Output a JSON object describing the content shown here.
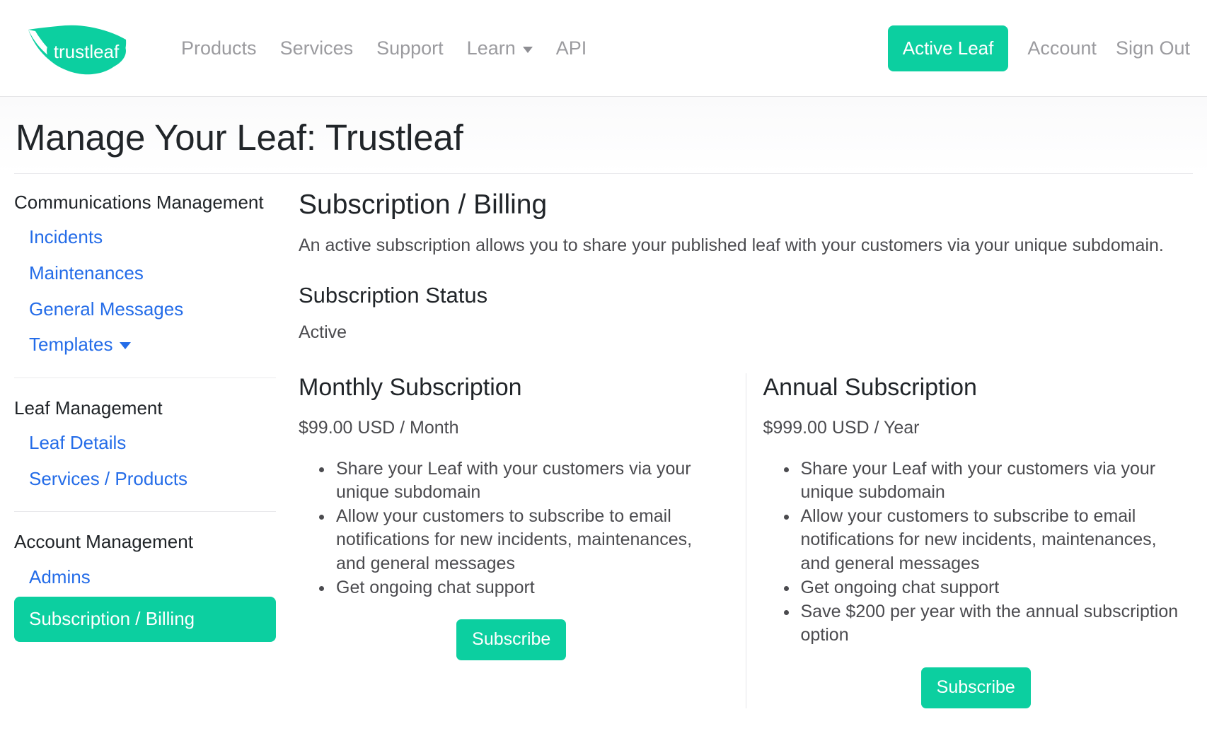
{
  "header": {
    "logo_text": "trustleaf",
    "logo_icon": "leaf-icon",
    "nav_links": [
      {
        "label": "Products"
      },
      {
        "label": "Services"
      },
      {
        "label": "Support"
      },
      {
        "label": "Learn",
        "has_caret": true
      },
      {
        "label": "API"
      }
    ],
    "active_leaf_button": "Active Leaf",
    "account_link": "Account",
    "sign_out_link": "Sign Out",
    "accent_color": "#0ccfa0",
    "nav_text_color": "#9b9b9f"
  },
  "page": {
    "title": "Manage Your Leaf: Trustleaf"
  },
  "sidebar": {
    "groups": [
      {
        "heading": "Communications Management",
        "items": [
          {
            "label": "Incidents",
            "active": false
          },
          {
            "label": "Maintenances",
            "active": false
          },
          {
            "label": "General Messages",
            "active": false
          },
          {
            "label": "Templates",
            "active": false,
            "has_caret": true
          }
        ]
      },
      {
        "heading": "Leaf Management",
        "items": [
          {
            "label": "Leaf Details",
            "active": false
          },
          {
            "label": "Services / Products",
            "active": false
          }
        ]
      },
      {
        "heading": "Account Management",
        "items": [
          {
            "label": "Admins",
            "active": false
          },
          {
            "label": "Subscription / Billing",
            "active": true
          }
        ]
      }
    ],
    "link_color": "#246ce8",
    "active_bg": "#0ccfa0"
  },
  "main": {
    "title": "Subscription / Billing",
    "lead": "An active subscription allows you to share your published leaf with your customers via your unique subdomain.",
    "status_heading": "Subscription Status",
    "status_value": "Active",
    "plans": [
      {
        "title": "Monthly Subscription",
        "price": "$99.00 USD / Month",
        "features": [
          "Share your Leaf with your customers via your unique subdomain",
          "Allow your customers to subscribe to email notifications for new incidents, maintenances, and general messages",
          "Get ongoing chat support"
        ],
        "cta": "Subscribe"
      },
      {
        "title": "Annual Subscription",
        "price": "$999.00 USD / Year",
        "features": [
          "Share your Leaf with your customers via your unique subdomain",
          "Allow your customers to subscribe to email notifications for new incidents, maintenances, and general messages",
          "Get ongoing chat support",
          "Save $200 per year with the annual subscription option"
        ],
        "cta": "Subscribe"
      }
    ]
  }
}
